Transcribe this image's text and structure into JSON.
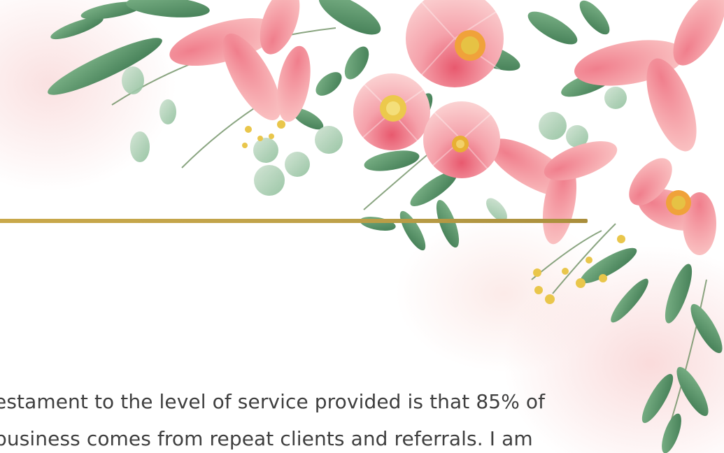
{
  "document": {
    "paragraph": "estament to the level of service provided is that 85% of\nbusiness comes from repeat clients and referrals. I am"
  },
  "colors": {
    "divider_gold": "#c4a34a",
    "text": "#3f3f3f",
    "petal_pink": "#f6b3b8",
    "leaf_green": "#5f9a6b"
  },
  "decorations": {
    "floral_icon": "pink-floral-arrangement-icon"
  }
}
